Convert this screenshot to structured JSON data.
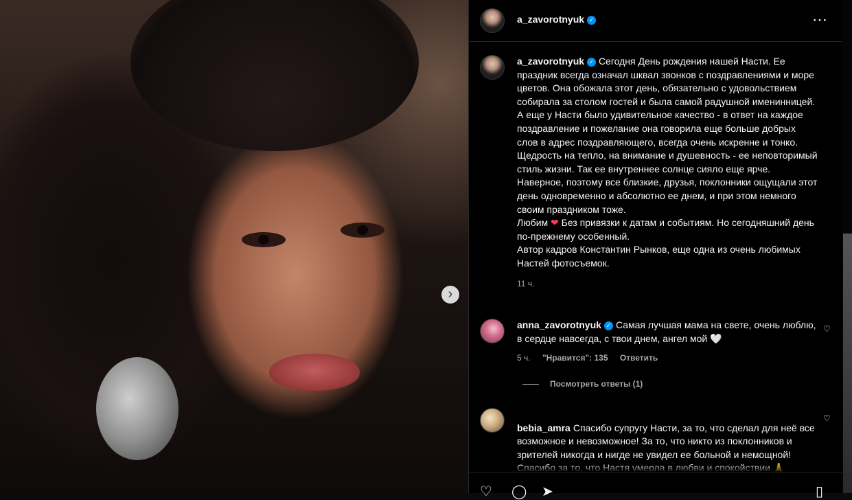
{
  "post": {
    "author": "a_zavorotnyuk",
    "caption": [
      "Сегодня День рождения нашей Насти. Ее праздник всегда означал шквал звонков с поздравлениями и море цветов. Она обожала этот день, обязательно с удовольствием собирала за столом гостей и была самой радушной именинницей. А еще у Насти было удивительное качество - в ответ на каждое поздравление и пожелание она говорила еще больше добрых слов в адрес поздравляющего, всегда очень искренне и тонко. Щедрость на тепло, на внимание и душевность - ее неповторимый стиль жизни. Так ее внутреннее солнце сияло еще ярче. Наверное, поэтому все близкие, друзья, поклонники ощущали этот день одновременно и абсолютно ее днем, и при этом немного своим праздником тоже.",
      "Без привязки к датам и событиям. Но сегодняшний день по-прежнему особенный.",
      "Автор кадров Константин Рынков, еще одна из очень любимых Настей фотосъемок."
    ],
    "love_word": "Любим",
    "time": "11 ч."
  },
  "comments": [
    {
      "username": "anna_zavorotnyuk",
      "verified": true,
      "text": "Самая лучшая мама на свете, очень люблю, в сердце навсегда, с твои днем, ангел мой 🤍",
      "time": "5 ч.",
      "likes": "\"Нравится\": 135",
      "reply_label": "Ответить",
      "view_replies": "Посмотреть ответы (1)"
    },
    {
      "username": "bebia_amra",
      "verified": false,
      "text": "Спасибо супругу Насти, за то, что сделал для неё все возможное и невозможное! За то, что никто из поклонников и зрителей никогда и нигде не увидел ее больной и немощной!\nСпасибо за то, что Настя умерла в любви и спокойствии 🙏"
    }
  ],
  "icons": {
    "more": "more-icon",
    "verified": "verified-badge-icon",
    "like": "heart-icon",
    "comment": "comment-icon",
    "share": "share-icon",
    "save": "bookmark-icon",
    "next": "chevron-right-icon"
  },
  "colors": {
    "background": "#000000",
    "text": "#f5f5f5",
    "muted": "#a8a8a8",
    "verified": "#0095f6",
    "heart": "#ff3b5c"
  }
}
